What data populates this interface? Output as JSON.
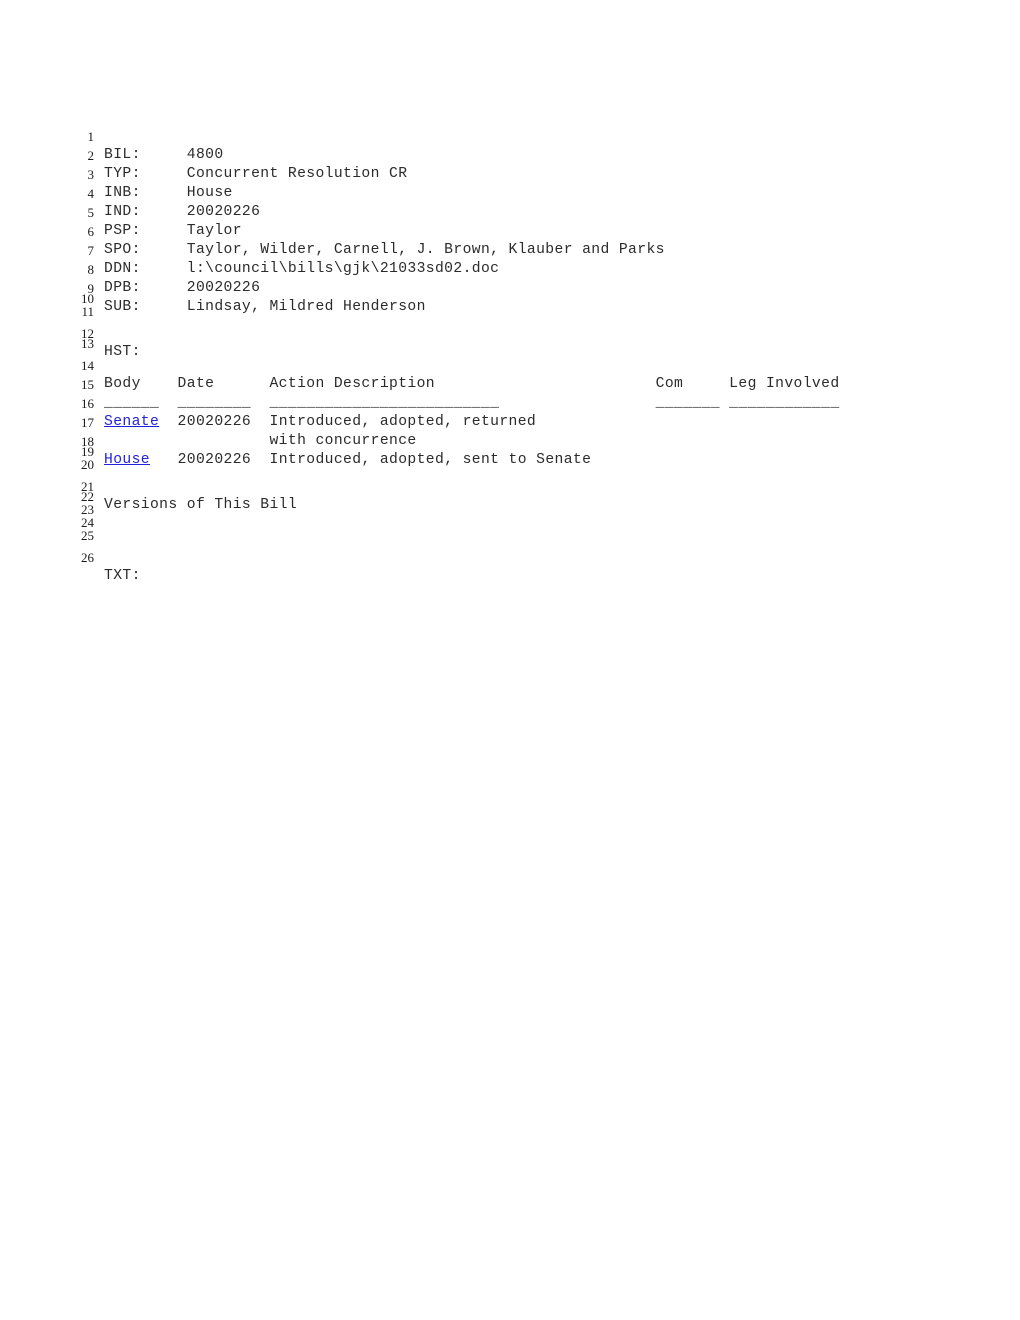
{
  "document": {
    "fields": [
      {
        "key": "BIL:",
        "value": "4800"
      },
      {
        "key": "TYP:",
        "value": "Concurrent Resolution CR"
      },
      {
        "key": "INB:",
        "value": "House"
      },
      {
        "key": "IND:",
        "value": "20020226"
      },
      {
        "key": "PSP:",
        "value": "Taylor"
      },
      {
        "key": "SPO:",
        "value": "Taylor, Wilder, Carnell, J. Brown, Klauber and Parks"
      },
      {
        "key": "DDN:",
        "value": "l:\\council\\bills\\gjk\\21033sd02.doc"
      },
      {
        "key": "DPB:",
        "value": "20020226"
      },
      {
        "key": "SUB:",
        "value": "Lindsay, Mildred Henderson"
      }
    ],
    "history_label": "HST:",
    "history_table": {
      "headers": [
        "Body",
        "Date",
        "Action Description",
        "Com",
        "Leg Involved"
      ],
      "separator": [
        "______",
        "________",
        "_________________________",
        "_______",
        "____________"
      ],
      "rows": [
        {
          "body": "Senate",
          "body_is_link": true,
          "date": "20020226",
          "action": "Introduced, adopted, returned",
          "action_cont": "with concurrence",
          "com": "",
          "leg_involved": ""
        },
        {
          "body": "House",
          "body_is_link": true,
          "date": "20020226",
          "action": "Introduced, adopted, sent to Senate",
          "action_cont": "",
          "com": "",
          "leg_involved": ""
        }
      ]
    },
    "versions_label": "Versions of This Bill",
    "text_label": "TXT:",
    "link_color": "#2222dd",
    "text_color": "#2b2b2b",
    "background_color": "#ffffff"
  },
  "lines": [
    {
      "n": "1",
      "text": "BIL:     4800"
    },
    {
      "n": "2",
      "text": "TYP:     Concurrent Resolution CR"
    },
    {
      "n": "3",
      "text": "INB:     House"
    },
    {
      "n": "4",
      "text": "IND:     20020226"
    },
    {
      "n": "5",
      "text": "PSP:     Taylor"
    },
    {
      "n": "6",
      "text": "SPO:     Taylor, Wilder, Carnell, J. Brown, Klauber and Parks"
    },
    {
      "n": "7",
      "text": "DDN:     l:\\council\\bills\\gjk\\21033sd02.doc"
    },
    {
      "n": "8",
      "text": "DPB:     20020226"
    },
    {
      "n": "9",
      "text": "SUB:     Lindsay, Mildred Henderson"
    },
    {
      "n": "10",
      "text": ""
    },
    {
      "n": "11",
      "text": ""
    },
    {
      "n": "12",
      "text": "HST:"
    },
    {
      "n": "13",
      "text": ""
    },
    {
      "n": "14",
      "text": "Body    Date      Action Description                        Com     Leg Involved"
    },
    {
      "n": "15",
      "text": "______  ________  _________________________                 _______ ____________"
    },
    {
      "n": "16",
      "text": ""
    },
    {
      "n": "17",
      "text": "                  with concurrence"
    },
    {
      "n": "18",
      "text": ""
    },
    {
      "n": "19",
      "text": ""
    },
    {
      "n": "20",
      "text": ""
    },
    {
      "n": "21",
      "text": "Versions of This Bill"
    },
    {
      "n": "22",
      "text": ""
    },
    {
      "n": "23",
      "text": ""
    },
    {
      "n": "24",
      "text": ""
    },
    {
      "n": "25",
      "text": ""
    },
    {
      "n": "26",
      "text": "TXT:"
    }
  ]
}
